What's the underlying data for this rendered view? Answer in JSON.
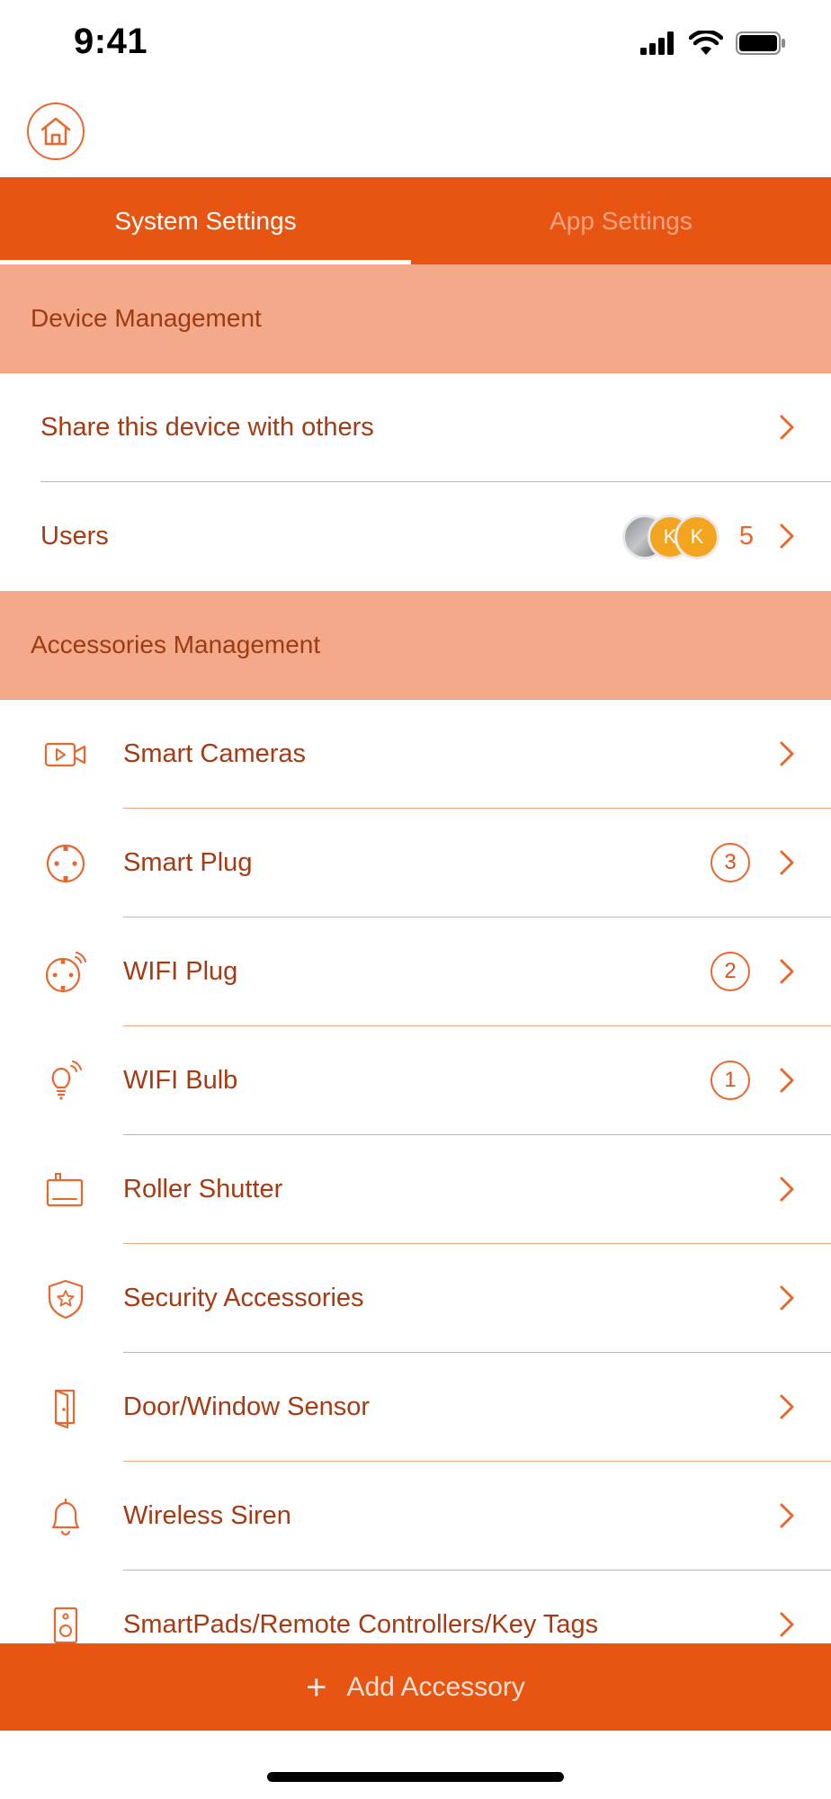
{
  "status_bar": {
    "time": "9:41"
  },
  "tabs": [
    {
      "label": "System Settings",
      "active": true
    },
    {
      "label": "App Settings",
      "active": false
    }
  ],
  "sections": {
    "device": {
      "title": "Device Management",
      "share_label": "Share this device with others",
      "users_label": "Users",
      "users_count": "5",
      "avatars": [
        "",
        "K",
        "K"
      ]
    },
    "accessories": {
      "title": "Accessories Management",
      "items": [
        {
          "label": "Smart Cameras",
          "icon": "camera-icon",
          "count": ""
        },
        {
          "label": "Smart Plug",
          "icon": "plug-icon",
          "count": "3"
        },
        {
          "label": "WIFI Plug",
          "icon": "wifi-plug-icon",
          "count": "2"
        },
        {
          "label": "WIFI Bulb",
          "icon": "wifi-bulb-icon",
          "count": "1"
        },
        {
          "label": "Roller Shutter",
          "icon": "roller-shutter-icon",
          "count": ""
        },
        {
          "label": "Security Accessories",
          "icon": "shield-star-icon",
          "count": ""
        },
        {
          "label": "Door/Window Sensor",
          "icon": "door-icon",
          "count": ""
        },
        {
          "label": "Wireless Siren",
          "icon": "bell-icon",
          "count": ""
        },
        {
          "label": "SmartPads/Remote Controllers/Key Tags",
          "icon": "remote-icon",
          "count": ""
        }
      ]
    }
  },
  "footer": {
    "add_label": "Add Accessory",
    "plus": "+"
  },
  "colors": {
    "accent": "#e85412",
    "section_bg": "#f4a98a",
    "text": "#a63a12",
    "icon": "#e8672f"
  }
}
